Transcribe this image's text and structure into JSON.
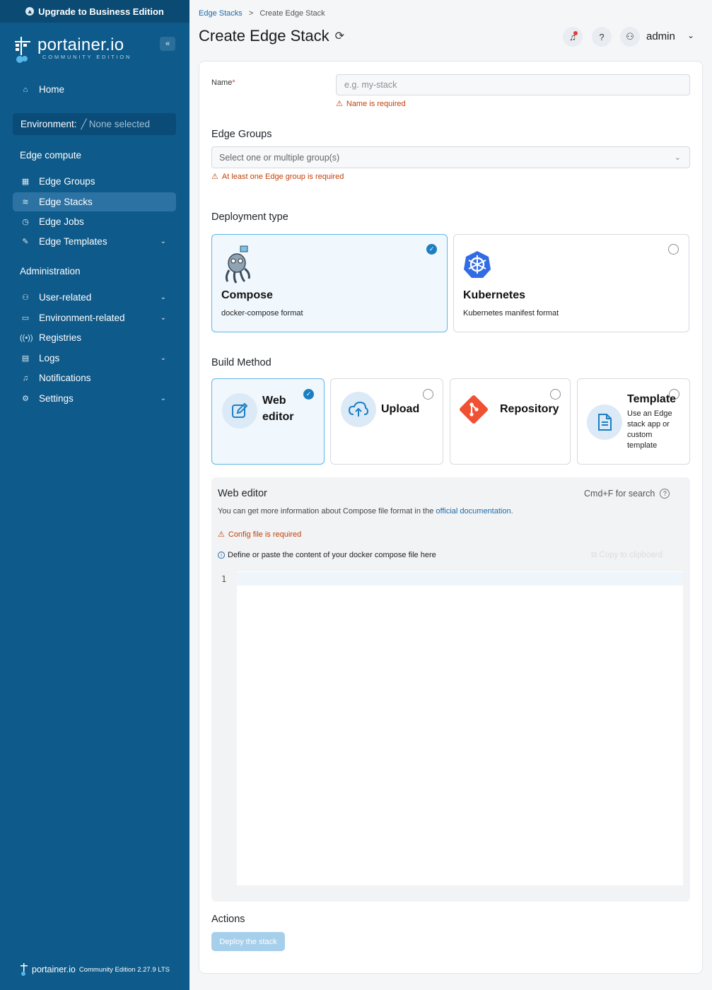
{
  "sidebar": {
    "upgrade_label": "Upgrade to Business Edition",
    "logo_text": "portainer.io",
    "logo_sub": "COMMUNITY EDITION",
    "collapse_glyph": "«",
    "home_label": "Home",
    "environment_label": "Environment:",
    "environment_value": "None selected",
    "edge_compute_label": "Edge compute",
    "edge_items": [
      {
        "label": "Edge Groups",
        "icon": "grid-icon"
      },
      {
        "label": "Edge Stacks",
        "icon": "layers-icon",
        "active": true
      },
      {
        "label": "Edge Jobs",
        "icon": "clock-icon"
      },
      {
        "label": "Edge Templates",
        "icon": "edit-icon"
      }
    ],
    "administration_label": "Administration",
    "admin_items": [
      {
        "label": "User-related",
        "icon": "users-icon"
      },
      {
        "label": "Environment-related",
        "icon": "drive-icon"
      },
      {
        "label": "Registries",
        "icon": "radio-icon"
      },
      {
        "label": "Logs",
        "icon": "file-icon"
      },
      {
        "label": "Notifications",
        "icon": "bell-icon"
      },
      {
        "label": "Settings",
        "icon": "gear-icon"
      }
    ],
    "footer_brand": "portainer.io",
    "footer_version": "Community Edition 2.27.9 LTS"
  },
  "header": {
    "breadcrumb_parent": "Edge Stacks",
    "breadcrumb_sep": ">",
    "breadcrumb_current": "Create Edge Stack",
    "title": "Create Edge Stack",
    "user": "admin"
  },
  "form": {
    "name_label": "Name",
    "name_required_mark": "*",
    "name_placeholder": "e.g. my-stack",
    "name_error": "Name is required",
    "edge_groups_title": "Edge Groups",
    "edge_groups_placeholder": "Select one or multiple group(s)",
    "edge_groups_error": "At least one Edge group is required",
    "deployment_title": "Deployment type",
    "deployment_options": [
      {
        "title": "Compose",
        "desc": "docker-compose format",
        "selected": true
      },
      {
        "title": "Kubernetes",
        "desc": "Kubernetes manifest format",
        "selected": false
      }
    ],
    "build_title": "Build Method",
    "build_options": [
      {
        "title_line1": "Web",
        "title_line2": "editor",
        "selected": true
      },
      {
        "title": "Upload",
        "selected": false
      },
      {
        "title": "Repository",
        "selected": false
      },
      {
        "title": "Template",
        "desc_lines": [
          "Use an Edge",
          "stack app or",
          "custom",
          "template"
        ],
        "selected": false
      }
    ]
  },
  "editor": {
    "title": "Web editor",
    "search_hint": "Cmd+F for search",
    "info_prefix": "You can get more information about Compose file format in the",
    "info_link": "official documentation.",
    "config_error": "Config file is required",
    "define_hint": "Define or paste the content of your docker compose file here",
    "copy_label": "Copy to clipboard",
    "line_number": "1"
  },
  "actions": {
    "title": "Actions",
    "deploy_label": "Deploy the stack"
  },
  "colors": {
    "sidebar": "#0e5a8a",
    "accent": "#1d7fc2",
    "error": "#c2410c"
  }
}
